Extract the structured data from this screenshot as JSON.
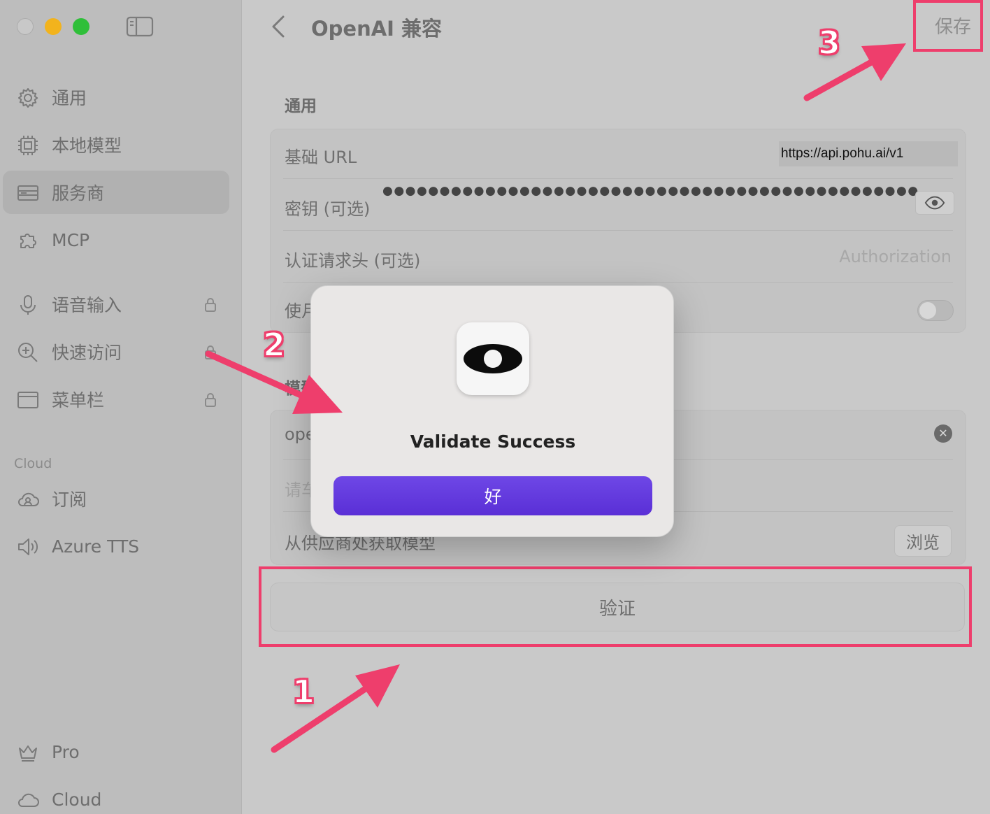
{
  "sidebar": {
    "items": [
      {
        "label": "通用",
        "icon": "gear-icon"
      },
      {
        "label": "本地模型",
        "icon": "chip-icon"
      },
      {
        "label": "服务商",
        "icon": "server-icon",
        "active": true
      },
      {
        "label": "MCP",
        "icon": "puzzle-icon"
      },
      {
        "label": "语音输入",
        "icon": "microphone-icon",
        "locked": true
      },
      {
        "label": "快速访问",
        "icon": "zoom-icon",
        "locked": true
      },
      {
        "label": "菜单栏",
        "icon": "window-icon",
        "locked": true
      },
      {
        "label": "订阅",
        "icon": "cloud-user-icon"
      },
      {
        "label": "Azure TTS",
        "icon": "speaker-icon"
      },
      {
        "label": "Pro",
        "icon": "crown-icon"
      },
      {
        "label": "Cloud",
        "icon": "cloud-icon"
      }
    ],
    "section_cloud": "Cloud"
  },
  "header": {
    "title": "OpenAI 兼容",
    "save_label": "保存"
  },
  "general": {
    "title": "通用",
    "base_url_label": "基础 URL",
    "base_url_value": "https://api.pohu.ai/v1",
    "api_key_label": "密钥 (可选)",
    "api_key_masked": "●●●●●●●●●●●●●●●●●●●●●●●●●●●●●●●●●●●●●●●●●●●●●●●",
    "auth_header_label": "认证请求头 (可选)",
    "auth_header_placeholder": "Authorization",
    "use_label_partial": "使月"
  },
  "models": {
    "section_partial": "模型",
    "model_value_partial": "ope",
    "input_placeholder_partial": "请车",
    "fetch_label": "从供应商处获取模型",
    "browse_label": "浏览"
  },
  "verify_label": "验证",
  "dialog": {
    "title": "Validate Success",
    "ok_label": "好"
  },
  "annotations": [
    "1",
    "2",
    "3"
  ],
  "colors": {
    "annotation": "#ee3e6c",
    "primary_button": "#5f35dc"
  }
}
